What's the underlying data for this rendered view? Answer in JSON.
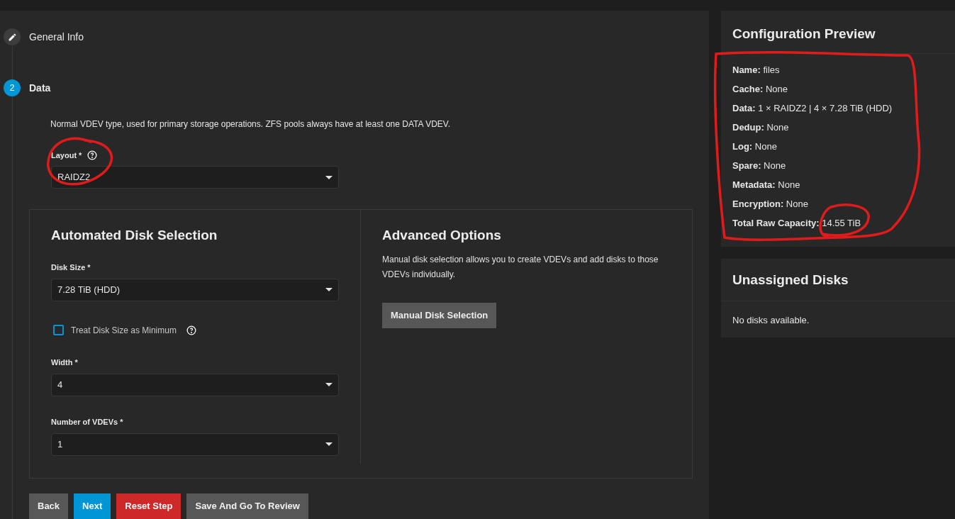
{
  "stepper": [
    {
      "kind": "edit",
      "label": "General Info",
      "selected": false
    },
    {
      "kind": "number",
      "number": "2",
      "label": "Data",
      "selected": true
    }
  ],
  "data_step": {
    "description": "Normal VDEV type, used for primary storage operations. ZFS pools always have at least one DATA VDEV.",
    "layout": {
      "label": "Layout *",
      "help": true,
      "value": "RAIDZ2"
    }
  },
  "automated": {
    "title": "Automated Disk Selection",
    "controls": [
      {
        "kind": "select",
        "label": "Disk Size *",
        "value": "7.28 TiB (HDD)"
      },
      {
        "kind": "checkbox",
        "label": "Treat Disk Size as Minimum",
        "checked": false,
        "help": true
      },
      {
        "kind": "select",
        "label": "Width *",
        "value": "4"
      },
      {
        "kind": "select",
        "label": "Number of VDEVs *",
        "value": "1"
      }
    ]
  },
  "advanced": {
    "title": "Advanced Options",
    "text": "Manual disk selection allows you to create VDEVs and add disks to those VDEVs individually.",
    "button": "Manual Disk Selection"
  },
  "buttons": [
    {
      "label": "Back",
      "kind": "default"
    },
    {
      "label": "Next",
      "kind": "primary"
    },
    {
      "label": "Reset Step",
      "kind": "danger"
    },
    {
      "label": "Save And Go To Review",
      "kind": "default"
    }
  ],
  "preview": {
    "title": "Configuration Preview",
    "rows": [
      {
        "label": "Name:",
        "value": "files"
      },
      {
        "label": "Cache:",
        "value": "None"
      },
      {
        "label": "Data:",
        "value": "1 × RAIDZ2 | 4 × 7.28 TiB (HDD)"
      },
      {
        "label": "Dedup:",
        "value": "None"
      },
      {
        "label": "Log:",
        "value": "None"
      },
      {
        "label": "Spare:",
        "value": "None"
      },
      {
        "label": "Metadata:",
        "value": "None"
      },
      {
        "label": "Encryption:",
        "value": "None"
      },
      {
        "label": "Total Raw Capacity:",
        "value": "14.55 TiB"
      }
    ]
  },
  "unassigned": {
    "title": "Unassigned Disks",
    "text": "No disks available."
  }
}
